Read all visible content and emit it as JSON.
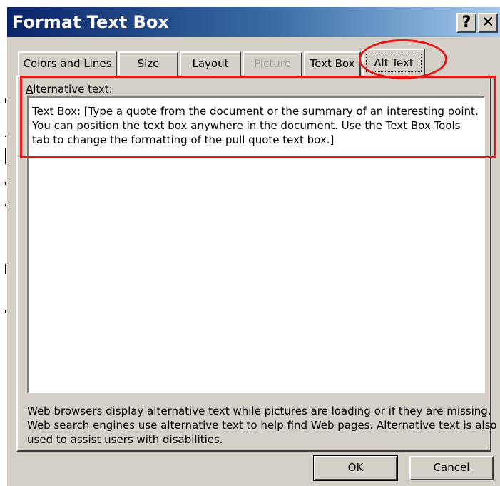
{
  "dialog": {
    "title": "Format Text Box",
    "help_label": "?",
    "close_label": "✕"
  },
  "tabs": [
    {
      "label": "Colors and Lines",
      "state": "normal"
    },
    {
      "label": "Size",
      "state": "normal"
    },
    {
      "label": "Layout",
      "state": "normal"
    },
    {
      "label": "Picture",
      "state": "disabled"
    },
    {
      "label": "Text Box",
      "state": "normal"
    },
    {
      "label": "Alt Text",
      "state": "active"
    }
  ],
  "alt_text": {
    "label_accesskey": "A",
    "label_rest": "lternative text:",
    "value": "Text Box: [Type a quote from the document or the summary of an interesting point. You can position the text box anywhere in the document. Use the Text Box Tools tab to change the formatting of the pull quote text box.]"
  },
  "note": "Web browsers display alternative text while pictures are loading or if they are missing.   Web search engines use alternative text to help find Web pages.  Alternative text is also used to assist users with disabilities.",
  "buttons": {
    "ok": "OK",
    "cancel": "Cancel"
  },
  "colors": {
    "title_gradient_start": "#0a246a",
    "title_gradient_end": "#a6caf0",
    "dialog_face": "#d4d0c8",
    "annotation_red": "#e01818"
  }
}
